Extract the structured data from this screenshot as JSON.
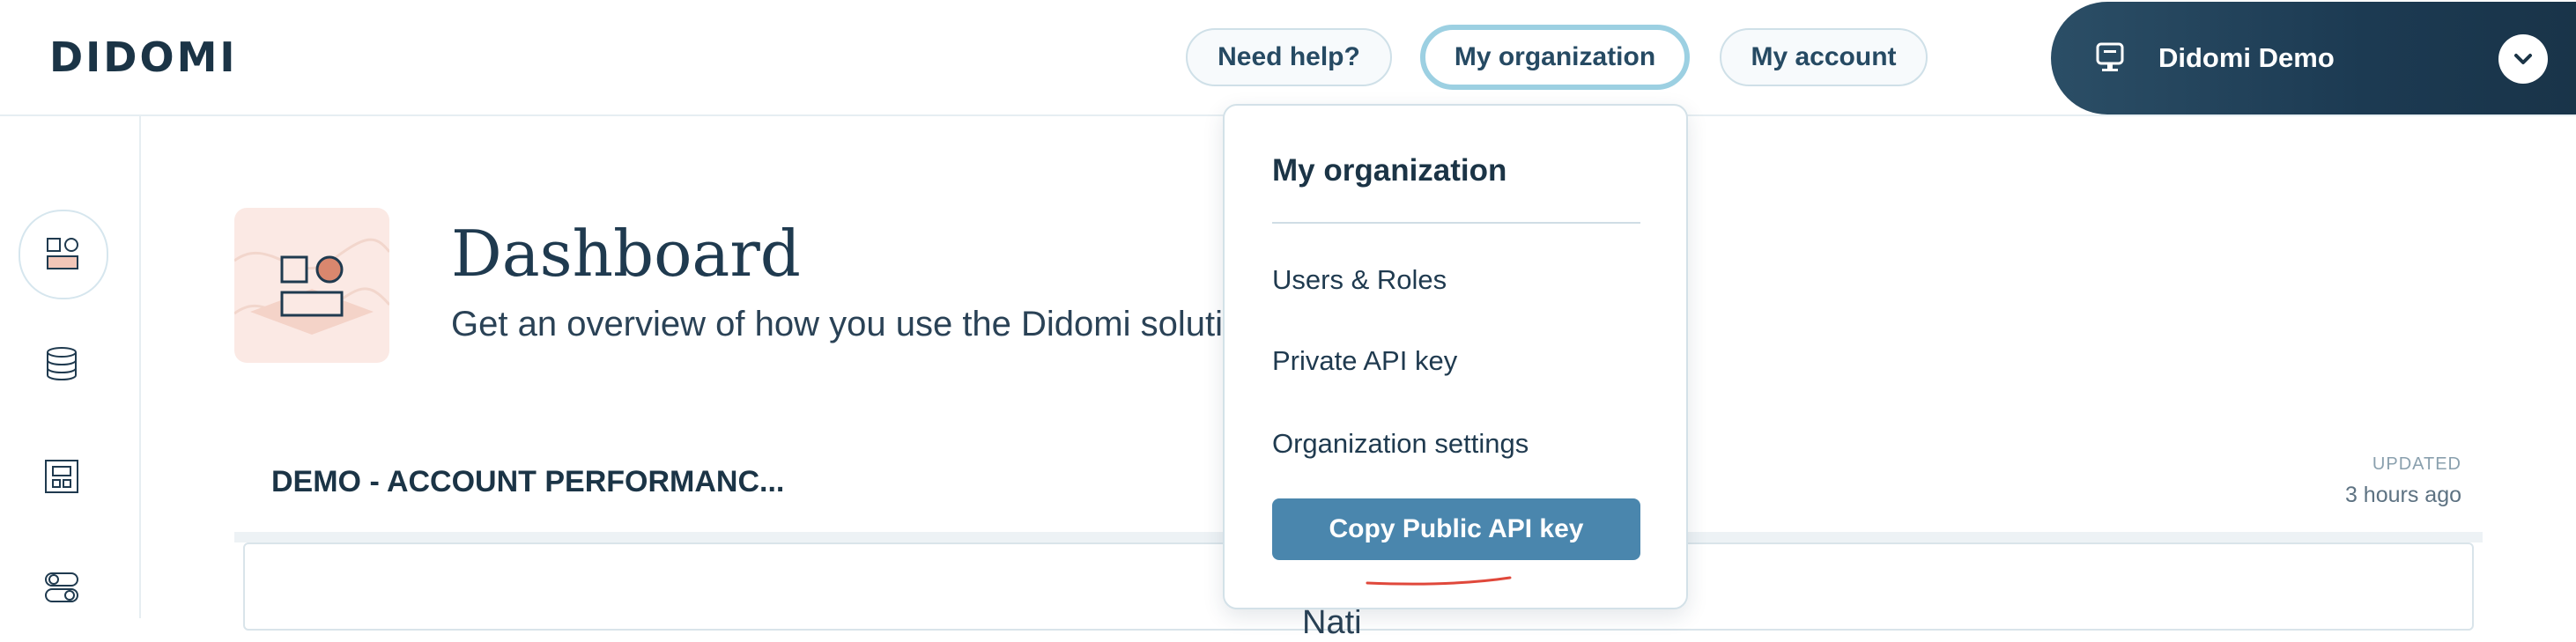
{
  "header": {
    "logo": "DIDOMI",
    "help_label": "Need help?",
    "org_label": "My organization",
    "account_label": "My account",
    "account_switcher": {
      "name": "Didomi Demo",
      "icon": "monitor-icon",
      "chevron": "chevron-down-icon"
    }
  },
  "sidebar": {
    "items": [
      {
        "icon": "dashboard-icon",
        "active": true
      },
      {
        "icon": "database-icon",
        "active": false
      },
      {
        "icon": "widget-icon",
        "active": false
      },
      {
        "icon": "toggles-icon",
        "active": false
      }
    ]
  },
  "dashboard": {
    "title": "Dashboard",
    "subtitle": "Get an overview of how you use the Didomi solutio"
  },
  "card": {
    "title": "DEMO - ACCOUNT PERFORMANC...",
    "updated_label": "UPDATED",
    "updated_value": "3 hours ago",
    "snippet": "Nati"
  },
  "org_menu": {
    "heading": "My organization",
    "items": [
      "Users & Roles",
      "Private API key",
      "Organization settings"
    ],
    "copy_button": "Copy Public API key"
  },
  "colors": {
    "navy": "#1b3446",
    "accent_blue": "#4a86ad",
    "focus_ring": "#9cd0e2",
    "thumb_bg": "#fbe9e4",
    "annotation_red": "#e0483b"
  }
}
